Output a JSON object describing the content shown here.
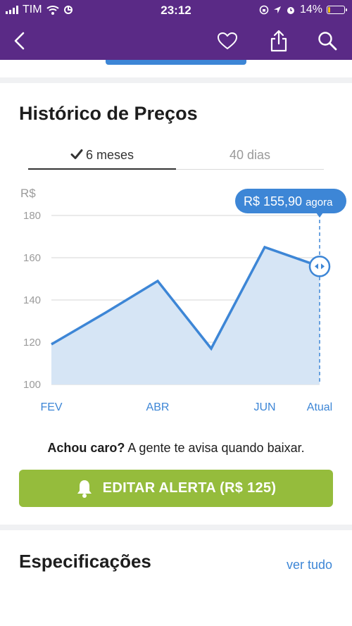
{
  "status_bar": {
    "carrier": "TIM",
    "time": "23:12",
    "battery_percent": "14%",
    "battery_level": 0.14,
    "icons": [
      "signal-icon",
      "wifi-icon",
      "link-icon",
      "screen-lock-icon",
      "location-icon",
      "alarm-icon",
      "battery-icon"
    ]
  },
  "navbar": {
    "background": "#5a2a86",
    "icons": [
      "back-chevron-icon",
      "heart-icon",
      "share-icon",
      "search-icon"
    ]
  },
  "price_history": {
    "title": "Histórico de Preços",
    "tabs": [
      {
        "label": "6 meses",
        "active": true,
        "icon": "checkmark-icon"
      },
      {
        "label": "40 dias",
        "active": false
      }
    ]
  },
  "chart_data": {
    "type": "area",
    "ylabel": "R$",
    "ylim": [
      100,
      180
    ],
    "yticks": [
      180,
      160,
      140,
      120,
      100
    ],
    "x_tick_labels": [
      "FEV",
      "ABR",
      "JUN",
      "Atual"
    ],
    "series": [
      {
        "x": [
          "FEV",
          "",
          "ABR",
          "",
          "JUN",
          "Atual"
        ],
        "values": [
          119,
          134,
          149,
          117,
          165,
          155.9
        ]
      }
    ],
    "current_label": "R$ 155,90",
    "current_suffix": "agora",
    "line_color": "#3d86d6",
    "fill_color": "#d6e5f5",
    "grid": true
  },
  "alert": {
    "text_bold": "Achou caro?",
    "text_rest": " A gente te avisa quando baixar.",
    "button_label": "EDITAR ALERTA (R$ 125)",
    "button_color": "#95bc3c",
    "button_icon": "bell-icon"
  },
  "specs": {
    "title": "Especificações",
    "link": "ver tudo"
  }
}
